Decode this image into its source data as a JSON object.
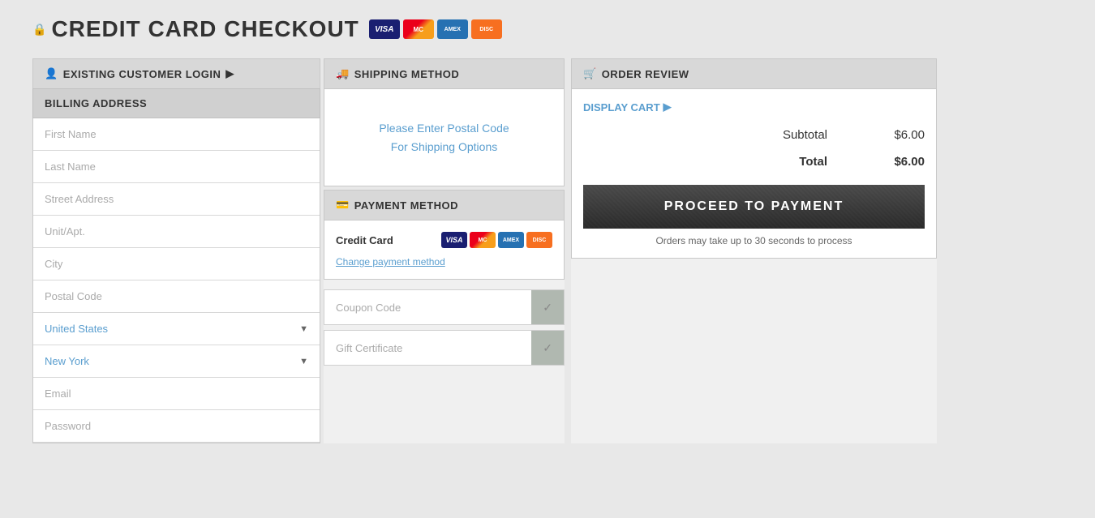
{
  "page": {
    "title": "CREDIT CARD CHECKOUT",
    "lock_icon": "🔒"
  },
  "cards": {
    "mastercard": "MC",
    "visa": "VISA",
    "amex": "AMEX",
    "discover": "DISC"
  },
  "existing_customer": {
    "header": "EXISTING CUSTOMER LOGIN",
    "icon": "👤",
    "arrow": "▶"
  },
  "billing": {
    "header": "BILLING ADDRESS",
    "fields": [
      {
        "placeholder": "First Name",
        "name": "first-name"
      },
      {
        "placeholder": "Last Name",
        "name": "last-name"
      },
      {
        "placeholder": "Street Address",
        "name": "street-address"
      },
      {
        "placeholder": "Unit/Apt.",
        "name": "unit-apt"
      },
      {
        "placeholder": "City",
        "name": "city"
      },
      {
        "placeholder": "Postal Code",
        "name": "postal-code"
      }
    ],
    "country": "United States",
    "state": "New York",
    "email_placeholder": "Email",
    "password_placeholder": "Password"
  },
  "shipping": {
    "header": "SHIPPING METHOD",
    "icon": "🚚",
    "message_line1": "Please Enter Postal Code",
    "message_line2": "For Shipping Options"
  },
  "payment": {
    "header": "PAYMENT METHOD",
    "icon": "💳",
    "method_label": "Credit Card",
    "change_link": "Change payment method",
    "coupon_placeholder": "Coupon Code",
    "gift_placeholder": "Gift Certificate",
    "check_symbol": "✓"
  },
  "order_review": {
    "header": "ORDER REVIEW",
    "cart_icon": "🛒",
    "display_cart": "DISPLAY CART",
    "arrow": "▶",
    "subtotal_label": "Subtotal",
    "subtotal_value": "$6.00",
    "total_label": "Total",
    "total_value": "$6.00",
    "proceed_label": "PROCEED TO PAYMENT",
    "process_notice": "Orders may take up to 30 seconds to process"
  }
}
